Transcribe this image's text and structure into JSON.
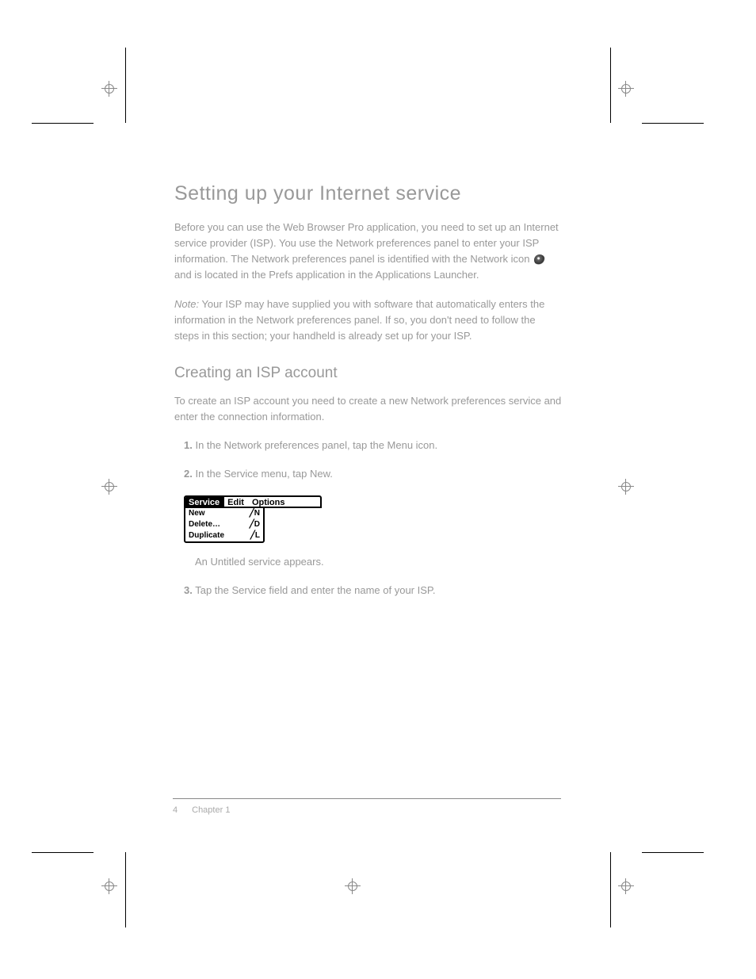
{
  "heading": "Setting up your Internet service",
  "p1_a": "Before you can use the Web Browser Pro application, you need to set up an Internet service provider (ISP). You use the Network preferences panel to enter your ISP information. The Network preferences panel is identified with the Network icon ",
  "p1_b": " and is located in the Prefs application in the Applications Launcher.",
  "note_label": "Note:",
  "note_text": " Your ISP may have supplied you with software that automatically enters the information in the Network preferences panel. If so, you don't need to follow the steps in this section; your handheld is already set up for your ISP.",
  "sub_heading": "Creating an ISP account",
  "p2": "To create an ISP account you need to create a new Network preferences service and enter the connection information.",
  "step1_label": "1.",
  "step1_text": " In the Network preferences panel, tap the Menu icon.",
  "step2_label": "2.",
  "step2_text": " In the Service menu, tap New.",
  "menubar": {
    "service": "Service",
    "edit": "Edit",
    "options": "Options"
  },
  "dropdown": [
    {
      "label": "New",
      "shortcut": "N"
    },
    {
      "label": "Delete…",
      "shortcut": "D"
    },
    {
      "label": "Duplicate",
      "shortcut": "L"
    }
  ],
  "p3": "An Untitled service appears.",
  "step3_label": "3.",
  "step3_text": " Tap the Service field and enter the name of your ISP.",
  "page_number": "4",
  "chapter": "Chapter 1"
}
